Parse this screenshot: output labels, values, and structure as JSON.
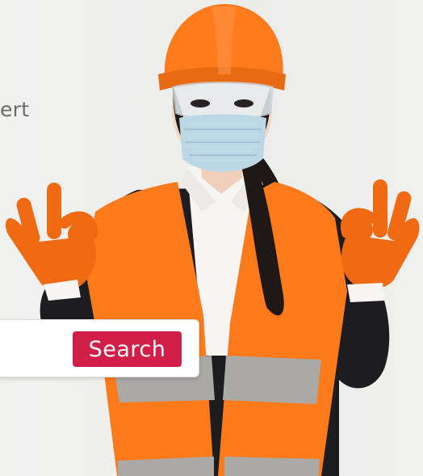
{
  "hero": {
    "headline_fragment": "ert"
  },
  "search": {
    "input_value": "",
    "placeholder": "",
    "button_label": "Search"
  },
  "colors": {
    "accent": "#d21f49",
    "vest": "#ff7a1a",
    "helmet": "#ff7b1c",
    "reflective_stripe": "#a9a9a6"
  },
  "photo": {
    "subject": "engineer-with-hardhat-mask-okay-gesture"
  }
}
